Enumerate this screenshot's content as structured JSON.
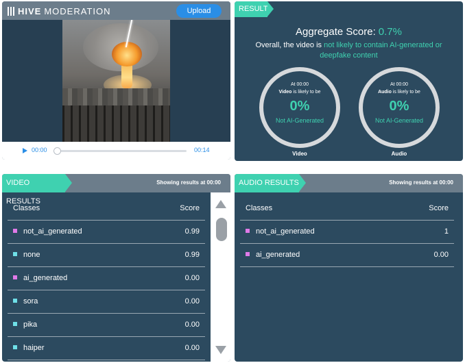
{
  "app": {
    "logo_bold": "HIVE",
    "logo_light": "MODERATION",
    "upload_label": "Upload"
  },
  "player": {
    "current_time": "00:00",
    "duration": "00:14",
    "progress": 0
  },
  "result": {
    "tab_label": "RESULT",
    "aggregate_label": "Aggregate Score:",
    "aggregate_value": "0.7%",
    "overall_prefix": "Overall, the video is",
    "overall_highlight": "not likely to contain AI-generated or deepfake content",
    "rings": [
      {
        "at": "At 00:00",
        "subject": "Video",
        "likely_text": "is likely to be",
        "percent": "0%",
        "label": "Not AI-Generated",
        "caption": "Video"
      },
      {
        "at": "At 00:00",
        "subject": "Audio",
        "likely_text": "is likely to be",
        "percent": "0%",
        "label": "Not AI-Generated",
        "caption": "Audio"
      }
    ]
  },
  "video_results": {
    "tab_label": "VIDEO RESULTS",
    "showing": "Showing results at 00:00",
    "col_classes": "Classes",
    "col_score": "Score",
    "rows": [
      {
        "name": "not_ai_generated",
        "score": "0.99",
        "color": "#e07ae8"
      },
      {
        "name": "none",
        "score": "0.99",
        "color": "#6fe0e8"
      },
      {
        "name": "ai_generated",
        "score": "0.00",
        "color": "#e07ae8"
      },
      {
        "name": "sora",
        "score": "0.00",
        "color": "#6fe0e8"
      },
      {
        "name": "pika",
        "score": "0.00",
        "color": "#6fe0e8"
      },
      {
        "name": "haiper",
        "score": "0.00",
        "color": "#6fe0e8"
      }
    ]
  },
  "audio_results": {
    "tab_label": "AUDIO RESULTS",
    "showing": "Showing results at 00:00",
    "col_classes": "Classes",
    "col_score": "Score",
    "rows": [
      {
        "name": "not_ai_generated",
        "score": "1",
        "color": "#e07ae8"
      },
      {
        "name": "ai_generated",
        "score": "0.00",
        "color": "#e07ae8"
      }
    ]
  },
  "colors": {
    "accent": "#3fd1b0",
    "panel": "#2c4a5f",
    "header": "#6c7d8b",
    "button": "#2a8ee6"
  }
}
